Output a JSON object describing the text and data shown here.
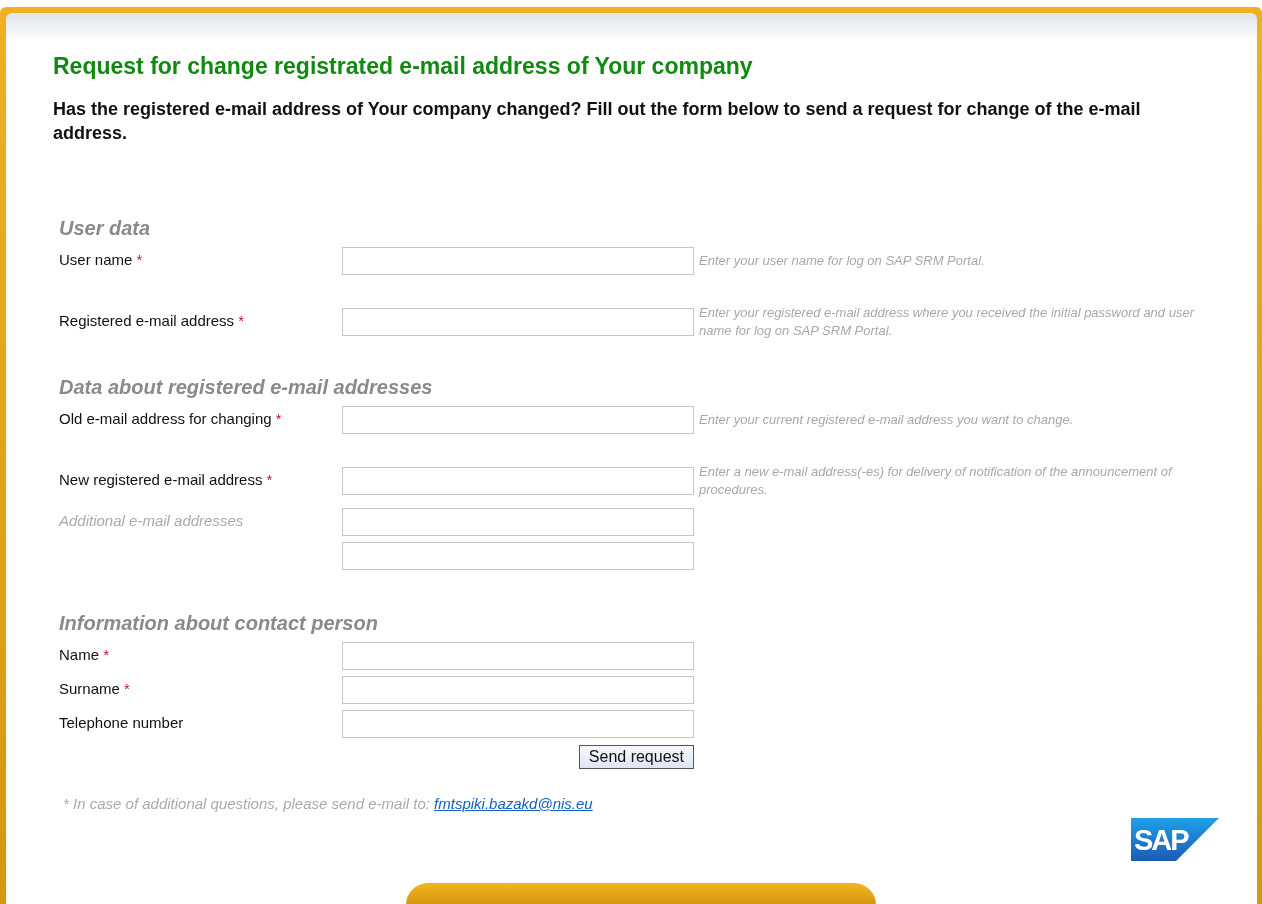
{
  "title": "Request for change registrated e-mail address of Your company",
  "intro": "Has the registered e-mail address of Your company changed? Fill out the form below to send a request for change of the e-mail address.",
  "required_marker": "*",
  "sections": [
    {
      "heading": "User data",
      "fields": [
        {
          "kind": "text",
          "label": "User name",
          "required": true,
          "hint": "Enter your user name for log on SAP SRM Portal."
        },
        {
          "kind": "text",
          "label": "Registered e-mail address",
          "required": true,
          "hint": "Enter your registered e-mail address where you received the initial password and user name for log on SAP SRM Portal."
        }
      ]
    },
    {
      "heading": "Data about registered e-mail addresses",
      "fields": [
        {
          "kind": "text",
          "label": "Old e-mail address for changing",
          "required": true,
          "hint": "Enter your current registered e-mail address you want to change."
        },
        {
          "kind": "text",
          "label": "New registered e-mail address",
          "required": true,
          "hint": "Enter a new e-mail address(-es) for delivery of notification of the announcement of procedures."
        },
        {
          "kind": "multi",
          "label": "Additional e-mail addresses",
          "required": false
        }
      ]
    },
    {
      "heading": "Information about contact person",
      "fields": [
        {
          "kind": "compact",
          "label": "Name",
          "required": true
        },
        {
          "kind": "compact",
          "label": "Surname",
          "required": true
        },
        {
          "kind": "compact",
          "label": "Telephone number",
          "required": false
        }
      ]
    }
  ],
  "submit": "Send request",
  "note": {
    "text": "* In case of additional questions, please send e-mail to:",
    "link": "fmtspiki.bazakd@nis.eu"
  },
  "logo": "SAP"
}
